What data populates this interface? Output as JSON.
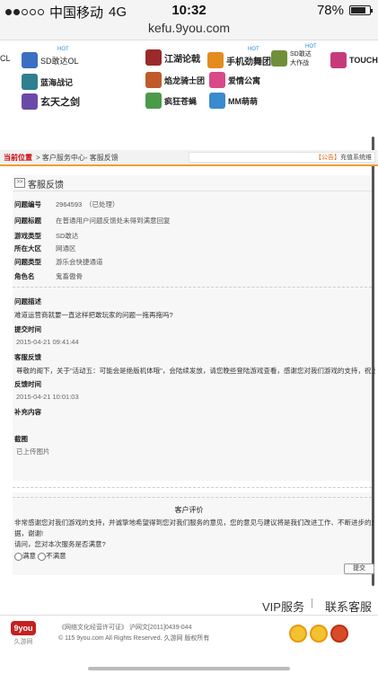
{
  "status": {
    "carrier": "中国移动",
    "network": "4G",
    "time": "10:32",
    "battery": "78%",
    "battery_level": 0.78
  },
  "url": "kefu.9you.com",
  "games": [
    {
      "label": "CL",
      "color": "#c23a3a"
    },
    {
      "label": "SD敢达OL",
      "color": "#3a6fc2",
      "hot": "HOT"
    },
    {
      "label": "江湖论戟",
      "color": "#9b2a2a"
    },
    {
      "label": "手机劲舞团",
      "color": "#e38b1f",
      "hot": "HOT"
    },
    {
      "label": "SD敢达大作战",
      "color": "#6f8f3a",
      "hot": "HOT"
    },
    {
      "label": "TOUCH",
      "color": "#c63a7a"
    },
    {
      "label": "蓝海战记",
      "color": "#2f7f8f"
    },
    {
      "label": "焰龙骑士团",
      "color": "#c05a2a"
    },
    {
      "label": "爱情公寓",
      "color": "#d94a8a"
    },
    {
      "label": "玄天之剑",
      "color": "#6a4aa8"
    },
    {
      "label": "疯狂苍蝇",
      "color": "#4a9a4a"
    },
    {
      "label": "MM萌萌",
      "color": "#3a8acf"
    }
  ],
  "breadcrumb": {
    "location": "当前位置",
    "path": "> 客户服务中心- 客服反馈",
    "notice_tag": "【公告】",
    "notice": "充值系统维"
  },
  "panel_title": "客服反馈",
  "fields": [
    {
      "key": "问题编号",
      "value": "2964593　（已处理）"
    },
    {
      "key": "问题标题",
      "value": "在普通用户问题反馈处未得到满意回复"
    },
    {
      "key": "游戏类型",
      "value": "SD敢达"
    },
    {
      "key": "所在大区",
      "value": "网通区"
    },
    {
      "key": "问题类型",
      "value": "游乐会快捷通道"
    },
    {
      "key": "角色名",
      "value": "鬼畜傲骨"
    }
  ],
  "detail": {
    "desc_label": "问题描述",
    "desc": "难道运营商就要一直这样把敢玩家的问题一拖再拖吗?",
    "submit_time_label": "提交时间",
    "submit_time": "2015-04-21 09:41:44",
    "reply_label": "客服反馈",
    "reply": "尊敬的阁下，关于\"活动五：可能会是绝版机体哦\"，会陆续发放，请您晚些登陆游戏查看，感谢您对我们游戏的支持，祝上！",
    "reply_time_label": "反馈时间",
    "reply_time": "2015-04-21 10:01:03",
    "extra_label": "补充内容",
    "screenshot_label": "截图",
    "uploaded": "已上传图片"
  },
  "evaluation": {
    "title": "客户评价",
    "text1": "非常感谢您对我们游戏的支持，并诚挚地希望得到您对我们服务的意见，您的意见与建议将是我们改进工作、不断进步的重要依",
    "text2": "据，谢谢!",
    "question": "请问，您对本次服务是否满意?",
    "opt_yes": "满意",
    "opt_no": "不满意",
    "submit": "提交"
  },
  "footer": {
    "vip": "VIP服务",
    "sep": "|",
    "service": "联系客服",
    "logo_mark": "9you",
    "logo_word": "久游网",
    "license": "《网络文化经营许可证》 沪网文[2011]0439-044",
    "copyright": "© 115 9you.com All Rights Reserved. 久游网 版权所有"
  }
}
